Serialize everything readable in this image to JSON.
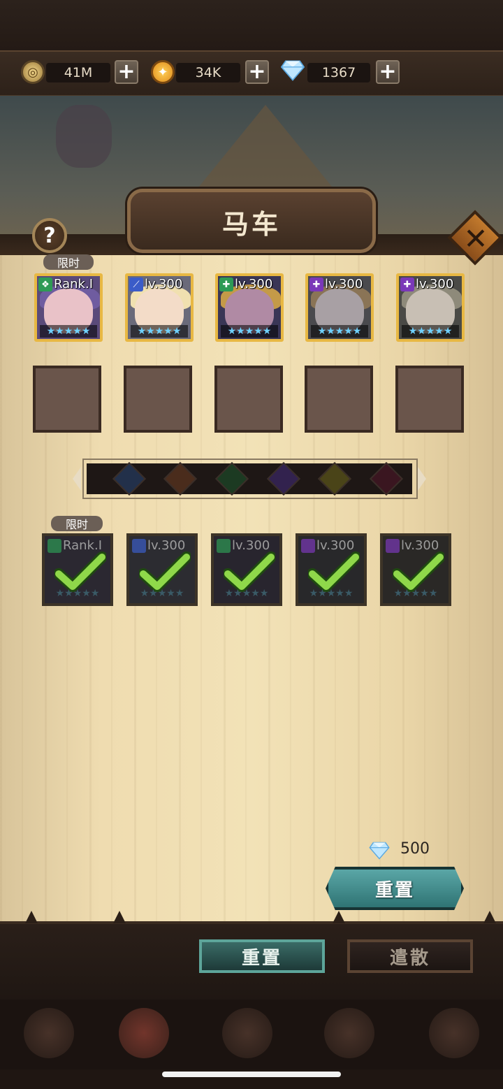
{
  "resources": [
    {
      "name": "gold",
      "icon": "gold-coin-icon",
      "value": "41M"
    },
    {
      "name": "token",
      "icon": "orange-token-icon",
      "value": "34K"
    },
    {
      "name": "diamond",
      "icon": "diamond-icon",
      "value": "1367"
    }
  ],
  "panel": {
    "title": "马车",
    "limited_tag": "限时"
  },
  "heroes": [
    {
      "level": "Rank.I",
      "class_color": "#2e9a55",
      "stars": "★★★★★"
    },
    {
      "level": "lv.300",
      "class_color": "#3b5cc8",
      "stars": "★★★★★"
    },
    {
      "level": "lv.300",
      "class_color": "#2e9a55",
      "stars": "★★★★★"
    },
    {
      "level": "lv.300",
      "class_color": "#7a38b8",
      "stars": "★★★★★"
    },
    {
      "level": "lv.300",
      "class_color": "#7a38b8",
      "stars": "★★★★★"
    }
  ],
  "selected": {
    "tag": "限时",
    "items": [
      {
        "level": "Rank.I",
        "class_color": "#2e9a55",
        "stars": "★★★★★"
      },
      {
        "level": "lv.300",
        "class_color": "#3b5cc8",
        "stars": "★★★★★"
      },
      {
        "level": "lv.300",
        "class_color": "#2e9a55",
        "stars": "★★★★★"
      },
      {
        "level": "lv.300",
        "class_color": "#7a38b8",
        "stars": "★★★★★"
      },
      {
        "level": "lv.300",
        "class_color": "#7a38b8",
        "stars": "★★★★★"
      }
    ]
  },
  "factions": [
    {
      "icon": "faction-blue-icon",
      "color": "#3a4a8a"
    },
    {
      "icon": "faction-orange-icon",
      "color": "#8a4a2a"
    },
    {
      "icon": "faction-green-icon",
      "color": "#2a6a3a"
    },
    {
      "icon": "faction-purple-icon",
      "color": "#5a3a8a"
    },
    {
      "icon": "faction-yellow-icon",
      "color": "#9a8a2a"
    },
    {
      "icon": "faction-red-icon",
      "color": "#6a2a3a"
    }
  ],
  "reset": {
    "cost": "500",
    "label": "重置"
  },
  "tabs": {
    "reset": "重置",
    "dismiss": "遣散"
  }
}
